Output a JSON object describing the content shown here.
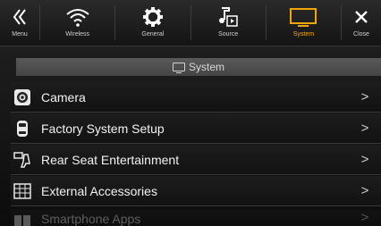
{
  "topbar": {
    "tabs": [
      {
        "label": "Menu",
        "icon": "double-chevron-left-icon"
      },
      {
        "label": "Wireless",
        "icon": "wifi-icon"
      },
      {
        "label": "General",
        "icon": "gear-icon"
      },
      {
        "label": "Source",
        "icon": "music-note-icon"
      },
      {
        "label": "System",
        "icon": "monitor-icon",
        "active": true
      },
      {
        "label": "Close",
        "icon": "close-icon"
      }
    ]
  },
  "section": {
    "title": "System"
  },
  "list": {
    "items": [
      {
        "label": "Camera",
        "icon": "camera-icon"
      },
      {
        "label": "Factory System Setup",
        "icon": "car-icon"
      },
      {
        "label": "Rear Seat Entertainment",
        "icon": "rear-seat-icon"
      },
      {
        "label": "External Accessories",
        "icon": "grid-panel-icon"
      },
      {
        "label": "Smartphone Apps",
        "icon": "phone-apps-icon"
      }
    ]
  },
  "colors": {
    "accent": "#f0a800",
    "background": "#000000",
    "header": "#4e4e4e"
  }
}
